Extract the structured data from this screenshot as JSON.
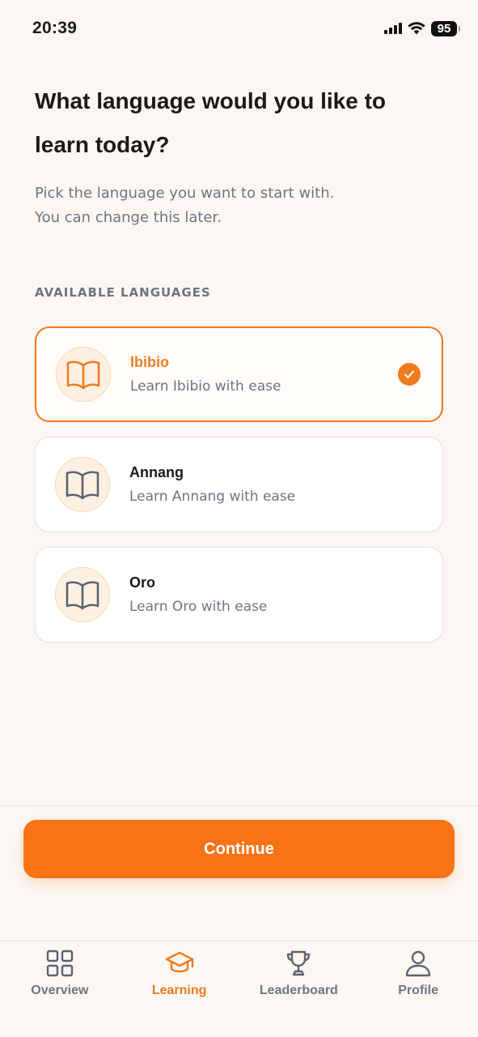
{
  "status_bar": {
    "time": "20:39",
    "battery": "95"
  },
  "header": {
    "title": "What language would you like to learn today?",
    "subtitle_line1": "Pick the language you want to start with.",
    "subtitle_line2": "You can change this later."
  },
  "section_label": "AVAILABLE LANGUAGES",
  "languages": [
    {
      "name": "Ibibio",
      "description": "Learn Ibibio with ease",
      "selected": true,
      "icon": "book-open-icon"
    },
    {
      "name": "Annang",
      "description": "Learn Annang with ease",
      "selected": false,
      "icon": "book-open-icon"
    },
    {
      "name": "Oro",
      "description": "Learn Oro with ease",
      "selected": false,
      "icon": "book-open-icon"
    }
  ],
  "continue_label": "Continue",
  "tabs": [
    {
      "label": "Overview",
      "icon": "grid-icon",
      "active": false
    },
    {
      "label": "Learning",
      "icon": "graduation-cap-icon",
      "active": true
    },
    {
      "label": "Leaderboard",
      "icon": "trophy-icon",
      "active": false
    },
    {
      "label": "Profile",
      "icon": "user-icon",
      "active": false
    }
  ],
  "colors": {
    "accent": "#f97316",
    "background": "#fbf7f3",
    "muted_text": "#6f7482",
    "card_border": "#e6e3e0"
  }
}
